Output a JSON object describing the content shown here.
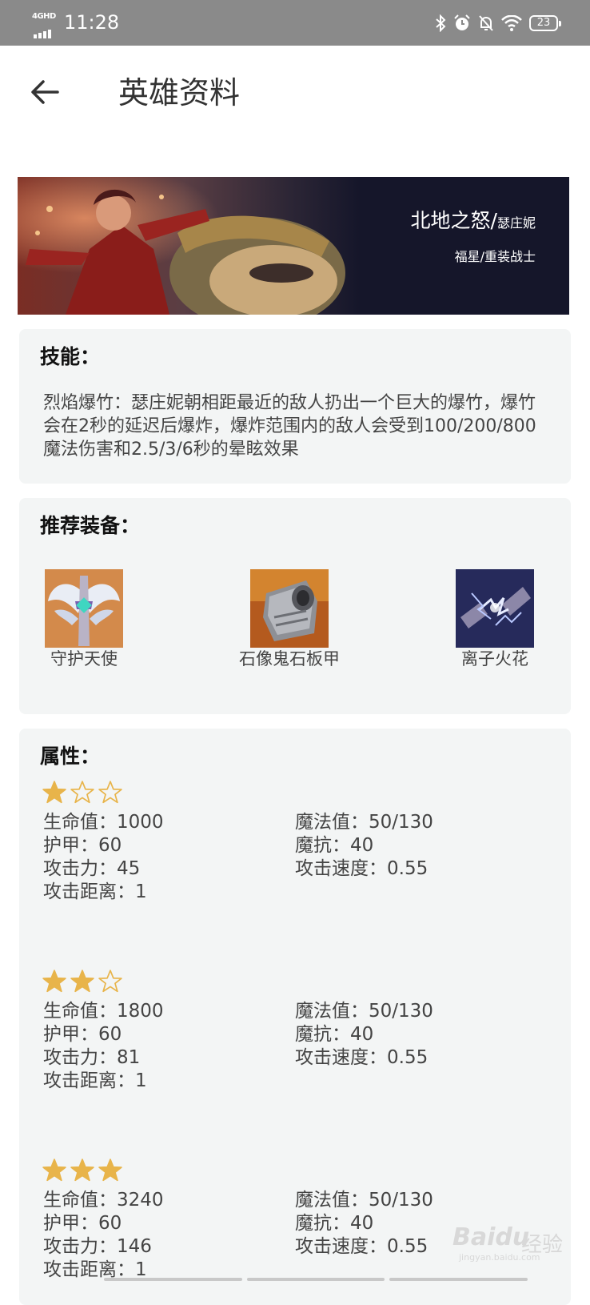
{
  "status_bar": {
    "network": "4GHD",
    "time": "11:28",
    "battery": "23"
  },
  "header": {
    "title": "英雄资料"
  },
  "hero": {
    "name": "北地之怒/",
    "alias": "瑟庄妮",
    "tags": "福星/重装战士"
  },
  "skill": {
    "heading": "技能：",
    "description": "烈焰爆竹：瑟庄妮朝相距最近的敌人扔出一个巨大的爆竹，爆竹会在2秒的延迟后爆炸，爆炸范围内的敌人会受到100/200/800魔法伤害和2.5/3/6秒的晕眩效果"
  },
  "equipment": {
    "heading": "推荐装备：",
    "items": [
      {
        "name": "守护天使",
        "icon": "guardian-angel-icon"
      },
      {
        "name": "石像鬼石板甲",
        "icon": "gargoyle-stoneplate-icon"
      },
      {
        "name": "离子火花",
        "icon": "ionic-spark-icon"
      }
    ]
  },
  "attributes": {
    "heading": "属性：",
    "levels": [
      {
        "stars": 1,
        "max_stars": 3,
        "health": "生命值：1000",
        "armor": "护甲：60",
        "attack": "攻击力：45",
        "range": "攻击距离：1",
        "mana": "魔法值：50/130",
        "mr": "魔抗：40",
        "speed": "攻击速度：0.55"
      },
      {
        "stars": 2,
        "max_stars": 3,
        "health": "生命值：1800",
        "armor": "护甲：60",
        "attack": "攻击力：81",
        "range": "攻击距离：1",
        "mana": "魔法值：50/130",
        "mr": "魔抗：40",
        "speed": "攻击速度：0.55"
      },
      {
        "stars": 3,
        "max_stars": 3,
        "health": "生命值：3240",
        "armor": "护甲：60",
        "attack": "攻击力：146",
        "range": "攻击距离：1",
        "mana": "魔法值：50/130",
        "mr": "魔抗：40",
        "speed": "攻击速度：0.55"
      }
    ]
  },
  "watermark": {
    "brand": "Baidu",
    "label": "经验",
    "url": "jingyan.baidu.com"
  },
  "colors": {
    "star": "#e8b44a",
    "card_bg": "#f3f5f5",
    "status_bar": "#8a8a8a"
  }
}
